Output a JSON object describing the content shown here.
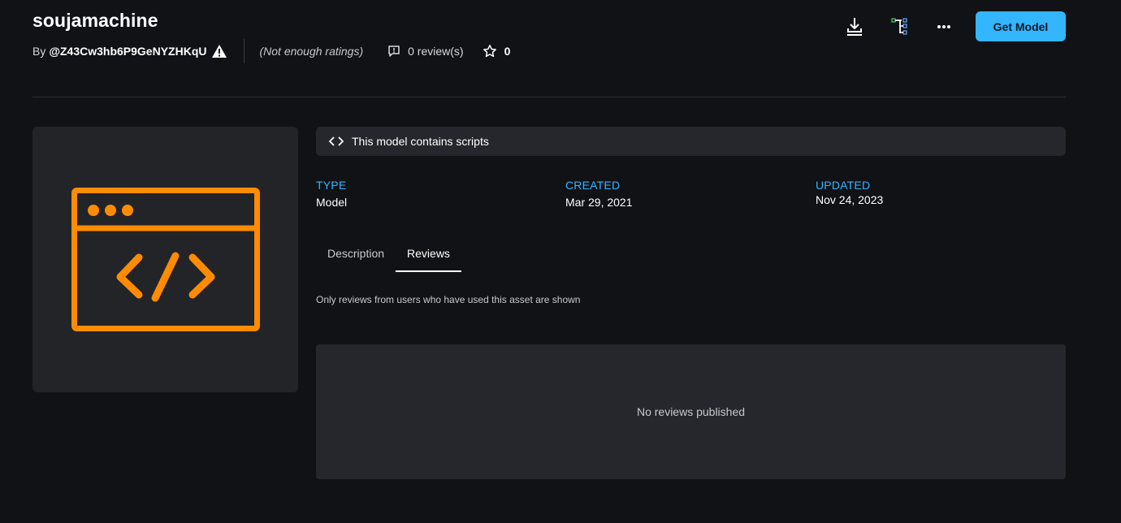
{
  "asset": {
    "title": "soujamachine",
    "by_label": "By",
    "creator": "@Z43Cw3hb6P9GeNYZHKqU",
    "warning_icon": "warning-icon",
    "ratings_text": "(Not enough ratings)",
    "reviews_count": "0 review(s)",
    "favorites_count": "0"
  },
  "actions": {
    "download_icon": "download-icon",
    "hierarchy_icon": "hierarchy-icon",
    "more_icon": "more-icon",
    "get_button": "Get Model"
  },
  "thumbnail": {
    "icon": "code-window-icon",
    "color": "#ff8c00"
  },
  "banner": {
    "icon": "code-brackets-icon",
    "text": "This model contains scripts"
  },
  "details": [
    {
      "label": "TYPE",
      "value": "Model"
    },
    {
      "label": "CREATED",
      "value": "Mar 29, 2021"
    },
    {
      "label": "UPDATED",
      "value": "Nov 24, 2023"
    }
  ],
  "tabs": [
    {
      "label": "Description",
      "active": false
    },
    {
      "label": "Reviews",
      "active": true
    }
  ],
  "reviews": {
    "note": "Only reviews from users who have used this asset are shown",
    "empty_text": "No reviews published"
  },
  "colors": {
    "accent": "#33b5ff",
    "background": "#111216",
    "panel": "#26272c",
    "thumbnail_icon": "#ff8c00"
  }
}
